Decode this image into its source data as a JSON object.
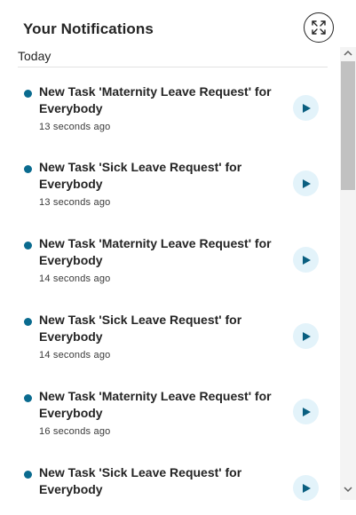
{
  "header": {
    "title": "Your Notifications",
    "expand_icon": "expand-arrows-icon"
  },
  "section": {
    "label": "Today"
  },
  "notifications": [
    {
      "message": "New Task 'Maternity Leave Request' for Everybody",
      "time": "13 seconds ago"
    },
    {
      "message": "New Task 'Sick Leave Request' for Everybody",
      "time": "13 seconds ago"
    },
    {
      "message": "New Task 'Maternity Leave Request' for Everybody",
      "time": "14 seconds ago"
    },
    {
      "message": "New Task 'Sick Leave Request' for Everybody",
      "time": "14 seconds ago"
    },
    {
      "message": "New Task 'Maternity Leave Request' for Everybody",
      "time": "16 seconds ago"
    },
    {
      "message": "New Task 'Sick Leave Request' for Everybody",
      "time": ""
    }
  ],
  "colors": {
    "unread_dot": "#0a6b8f",
    "play_button_bg": "#e3f3fa",
    "play_icon": "#0a5f80"
  }
}
